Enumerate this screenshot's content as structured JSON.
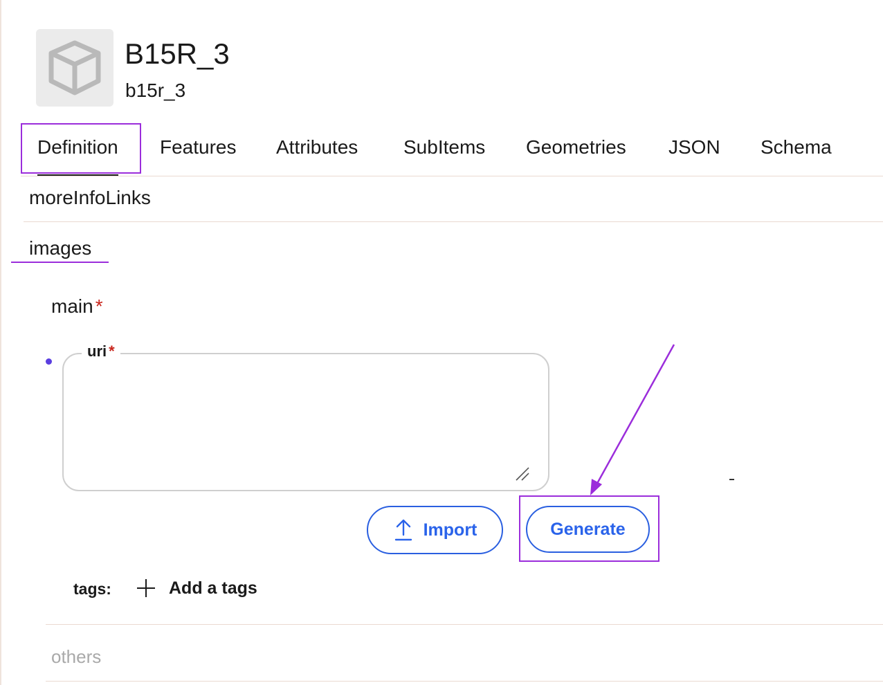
{
  "header": {
    "title": "B15R_3",
    "subtitle": "b15r_3",
    "thumbnail_icon": "cube-icon"
  },
  "tabs": [
    {
      "label": "Definition",
      "active": true
    },
    {
      "label": "Features",
      "active": false
    },
    {
      "label": "Attributes",
      "active": false
    },
    {
      "label": "SubItems",
      "active": false
    },
    {
      "label": "Geometries",
      "active": false
    },
    {
      "label": "JSON",
      "active": false
    },
    {
      "label": "Schema",
      "active": false
    }
  ],
  "sections": {
    "cut_off_label": "moreInfoLinks",
    "images_label": "images",
    "others_label": "others"
  },
  "form": {
    "main_label": "main",
    "required_mark": "*",
    "uri_label": "uri",
    "uri_value": "",
    "import_label": "Import",
    "import_icon": "upload-arrow-icon",
    "generate_label": "Generate",
    "tags_label": "tags:",
    "add_tags_label": "Add a tags",
    "add_tags_icon": "plus-icon"
  },
  "colors": {
    "annotation": "#9b2ddb",
    "button_blue": "#2a63ea",
    "required_red": "#c8241b",
    "bullet": "#5a3ee0",
    "divider": "#ead9d0"
  }
}
